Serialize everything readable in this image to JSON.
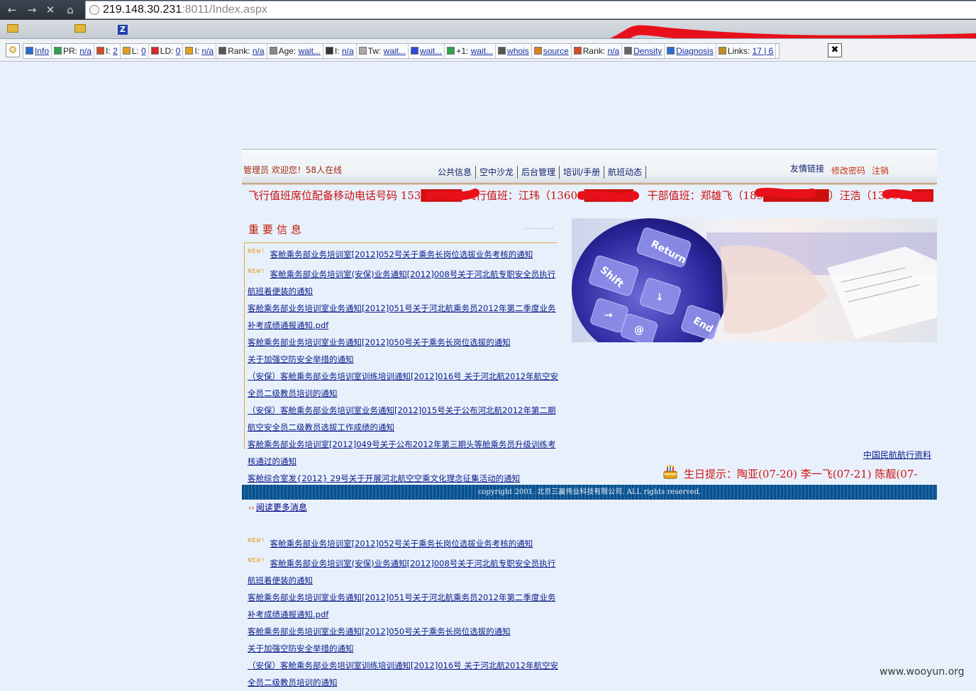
{
  "browser": {
    "address": {
      "host": "219.148.30.231",
      "path": ":8011/Index.aspx"
    },
    "nav_icons": [
      "back-icon",
      "forward-icon",
      "stop-icon",
      "home-icon"
    ]
  },
  "seo_toolbar": {
    "items": [
      {
        "icon": "info-icon",
        "label": "",
        "value": "Info"
      },
      {
        "icon": "pagerank-icon",
        "label": "PR: ",
        "value": "n/a"
      },
      {
        "icon": "index-icon",
        "label": "I: ",
        "value": "2"
      },
      {
        "icon": "links-icon",
        "label": "L: ",
        "value": "0"
      },
      {
        "icon": "linkdomain-icon",
        "label": "LD: ",
        "value": "0"
      },
      {
        "icon": "index2-icon",
        "label": "I: ",
        "value": "n/a"
      },
      {
        "icon": "rank-icon",
        "label": "Rank: ",
        "value": "n/a"
      },
      {
        "icon": "age-icon",
        "label": "Age: ",
        "value": "wait..."
      },
      {
        "icon": "delicious-icon",
        "label": "I: ",
        "value": "n/a"
      },
      {
        "icon": "twitter-icon",
        "label": "Tw: ",
        "value": "wait..."
      },
      {
        "icon": "facebook-icon",
        "label": "",
        "value": "wait..."
      },
      {
        "icon": "google-plus-icon",
        "label": "+1: ",
        "value": "wait..."
      },
      {
        "icon": "whois-icon",
        "label": "",
        "value": "whois"
      },
      {
        "icon": "source-icon",
        "label": "",
        "value": "source"
      },
      {
        "icon": "rank2-icon",
        "label": "Rank: ",
        "value": "n/a"
      },
      {
        "icon": "density-icon",
        "label": "",
        "value": "Density"
      },
      {
        "icon": "diagnosis-icon",
        "label": "",
        "value": "Diagnosis"
      },
      {
        "icon": "links-count-icon",
        "label": "Links: ",
        "value": "17 | 6"
      }
    ]
  },
  "header": {
    "admin_welcome": "管理员 欢迎您！58人在线",
    "nav": [
      "公共信息",
      "空中沙龙",
      "后台管理",
      "培训/手册",
      "航班动态"
    ],
    "friend_link": "友情链接",
    "change_password": "修改密码",
    "logout": "注销"
  },
  "duty_marquee": "飞行值班席位配备移动电话号码 153█████  飞行值班：江玮（13603██████）  干部值班：郑雄飞（189████████）汪浩（139081█████）",
  "important": {
    "title": "重要信息",
    "badge": "NEW!",
    "items": [
      {
        "new": true,
        "text": "客舱乘务部业务培训室[2012]052号关于乘务长岗位选拔业务考核的通知"
      },
      {
        "new": true,
        "text": "客舱乘务部业务培训室(安保)业务通知[2012]008号关于河北航专职安全员执行航班着便装的通知"
      },
      {
        "new": false,
        "text": "客舱乘务部业务培训室业务通知[2012]051号关于河北航乘务员2012年第二季度业务补考成绩通报通知.pdf"
      },
      {
        "new": false,
        "text": "客舱乘务部业务培训室业务通知[2012]050号关于乘务长岗位选拔的通知"
      },
      {
        "new": false,
        "text": "关于加强空防安全举措的通知"
      },
      {
        "new": false,
        "text": "（安保）客舱乘务部业务培训室训练培训通知[2012]016号 关于河北航2012年航空安全员二级教员培训的通知"
      },
      {
        "new": false,
        "text": "（安保）客舱乘务部业务培训室业务通知[2012]015号关于公布河北航2012年第二期航空安全员二级教员选拔工作成绩的通知"
      },
      {
        "new": false,
        "text": "客舱乘务部业务培训室[2012]049号关于公布2012年第三期头等舱乘务员升级训练考核通过的通知"
      },
      {
        "new": false,
        "text": "客舱综合室发{2012} 29号关于开展河北航空空乘文化理念征集活动的通知"
      }
    ],
    "bottom_items": [
      {
        "new": true,
        "text": "客舱乘务部业务培训室[2012]052号关于乘务长岗位选拔业务考核的通知"
      },
      {
        "new": true,
        "text": "客舱乘务部业务培训室(安保)业务通知[2012]008号关于河北航专职安全员执行航班着便装的通知"
      },
      {
        "new": false,
        "text": "客舱乘务部业务培训室业务通知[2012]051号关于河北航乘务员2012年第二季度业务补考成绩通报通知.pdf"
      },
      {
        "new": false,
        "text": "客舱乘务部业务培训室业务通知[2012]050号关于乘务长岗位选拔的通知"
      },
      {
        "new": false,
        "text": "关于加强空防安全举措的通知"
      },
      {
        "new": false,
        "text": "（安保）客舱乘务部业务培训室训练培训通知[2012]016号 关于河北航2012年航空安全员二级教员培训的通知"
      }
    ]
  },
  "hero_keys": [
    "Return",
    "Shift",
    "↓",
    "→",
    "@",
    "End"
  ],
  "caac_link": "中国民航航行资料",
  "birthday": {
    "text": "生日提示：陶亚(07-20) 李一飞(07-21) 陈靓(07-"
  },
  "footer": "copyright 2001. 北京三赢伟业科技有限公司. ALL rights reserved.",
  "read_more": "阅读更多消息",
  "watermark": "www.wooyun.org",
  "colors": {
    "page_bg": "#e8f1fb",
    "link": "#0a1a8a",
    "alert_red": "#cc1010",
    "footer_blue": "#0e4e8a",
    "new_badge": "#e89310"
  }
}
